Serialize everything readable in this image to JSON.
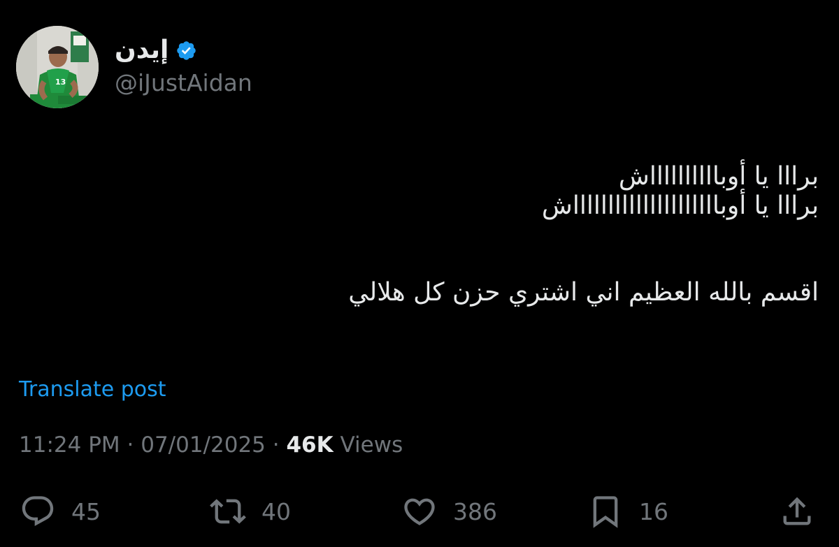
{
  "author": {
    "display_name": "إيدن",
    "handle": "@iJustAidan",
    "verified": true,
    "avatar_jersey_number": "13"
  },
  "tweet": {
    "lines": [
      "برااا يا أوبااااااااااش",
      "برااا يا أوباااااااااااااااااااااش",
      "اقسم بالله العظيم اني اشتري حزن كل هلالي"
    ],
    "translate_label": "Translate post"
  },
  "meta": {
    "time": "11:24 PM",
    "separator": "·",
    "date": "07/01/2025",
    "views_count": "46K",
    "views_label": "Views"
  },
  "actions": {
    "replies": "45",
    "reposts": "40",
    "likes": "386",
    "bookmarks": "16"
  },
  "colors": {
    "background": "#000000",
    "text": "#e7e9ea",
    "muted": "#71767b",
    "accent": "#1d9bf0"
  },
  "icons": [
    "verified-badge-icon",
    "reply-icon",
    "repost-icon",
    "like-icon",
    "bookmark-icon",
    "share-icon"
  ]
}
